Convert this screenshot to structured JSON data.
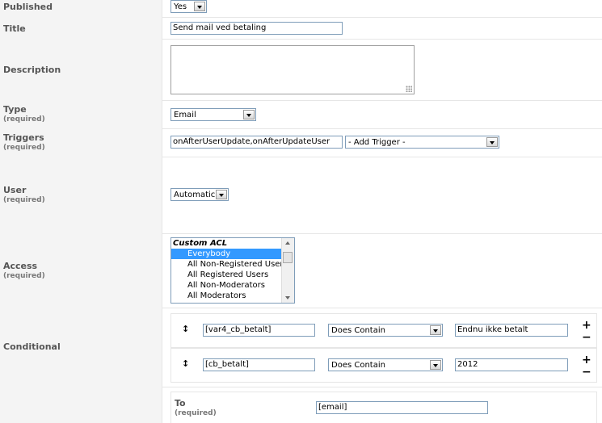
{
  "published": {
    "label": "Published",
    "value": "Yes"
  },
  "title": {
    "label": "Title",
    "value": "Send mail ved betaling"
  },
  "description": {
    "label": "Description",
    "value": ""
  },
  "type": {
    "label": "Type",
    "required": "(required)",
    "value": "Email"
  },
  "triggers": {
    "label": "Triggers",
    "required": "(required)",
    "value": "onAfterUserUpdate,onAfterUpdateUser",
    "add_trigger": "- Add Trigger -"
  },
  "user": {
    "label": "User",
    "required": "(required)",
    "value": "Automatic"
  },
  "access": {
    "label": "Access",
    "required": "(required)",
    "group": "Custom ACL",
    "options": [
      "Everybody",
      "All Non-Registered Users",
      "All Registered Users",
      "All Non-Moderators",
      "All Moderators"
    ],
    "selected": "Everybody"
  },
  "conditional": {
    "label": "Conditional",
    "rows": [
      {
        "field": "[var4_cb_betalt]",
        "operator": "Does Contain",
        "value": "Endnu ikke betalt"
      },
      {
        "field": "[cb_betalt]",
        "operator": "Does Contain",
        "value": "2012"
      }
    ],
    "drag_glyph": "↕",
    "plus": "+",
    "minus": "−"
  },
  "to": {
    "label": "To",
    "required": "(required)",
    "value": "[email]"
  }
}
